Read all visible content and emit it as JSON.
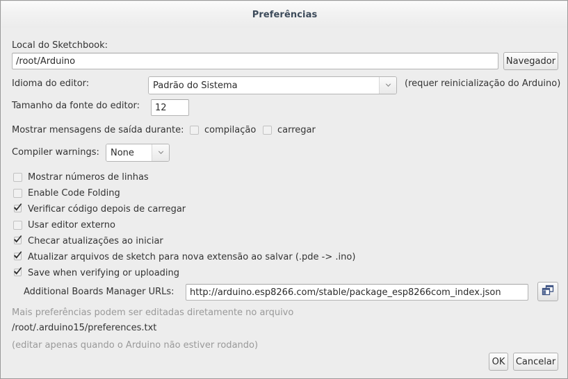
{
  "window": {
    "title": "Preferências"
  },
  "sketchbook": {
    "label": "Local do Sketchbook:",
    "path_value": "/root/Arduino",
    "browse_button": "Navegador"
  },
  "language": {
    "label": "Idioma do editor:",
    "selected": "Padrão do Sistema",
    "note": "(requer reinicialização do Arduino)"
  },
  "font_size": {
    "label": "Tamanho da fonte do editor:",
    "value": "12"
  },
  "verbose_output": {
    "label": "Mostrar mensagens de saída durante:",
    "options": [
      {
        "label": "compilação",
        "checked": false
      },
      {
        "label": "carregar",
        "checked": false
      }
    ]
  },
  "compiler_warnings": {
    "label": "Compiler warnings:",
    "selected": "None"
  },
  "checkboxes": [
    {
      "label": "Mostrar números de linhas",
      "checked": false
    },
    {
      "label": "Enable Code Folding",
      "checked": false
    },
    {
      "label": "Verificar código depois de carregar",
      "checked": true
    },
    {
      "label": "Usar editor externo",
      "checked": false
    },
    {
      "label": "Checar atualizações ao iniciar",
      "checked": true
    },
    {
      "label": "Atualizar arquivos de sketch para nova extensão ao salvar (.pde -> .ino)",
      "checked": true
    },
    {
      "label": "Save when verifying or uploading",
      "checked": true
    }
  ],
  "boards_urls": {
    "label": "Additional Boards Manager URLs:",
    "value": "http://arduino.esp8266.com/stable/package_esp8266com_index.json",
    "button_icon": "copy-windows-icon"
  },
  "footer": {
    "hint": "Mais preferências podem ser editadas diretamente no arquivo",
    "path": "/root/.arduino15/preferences.txt",
    "warning": "(editar apenas quando o Arduino não estiver rodando)"
  },
  "actions": {
    "ok": "OK",
    "cancel": "Cancelar"
  },
  "colors": {
    "title_text": "#3c4a5a",
    "dialog_bg": "#ededed",
    "muted_text": "#999999",
    "icon_blue": "#3a5080"
  }
}
